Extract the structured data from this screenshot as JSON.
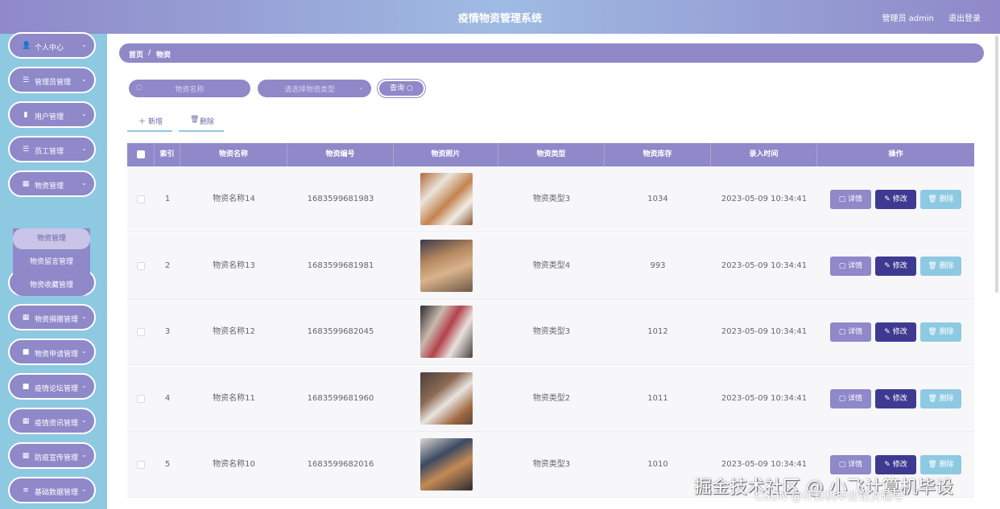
{
  "header": {
    "title": "疫情物资管理系统",
    "user": "管理员 admin",
    "logout": "退出登录"
  },
  "sidebar": {
    "items": [
      {
        "icon": "person-icon",
        "glyph": "👤",
        "label": "个人中心"
      },
      {
        "icon": "list-icon",
        "glyph": "☰",
        "label": "管理员管理"
      },
      {
        "icon": "bar-chart-icon",
        "glyph": "▮",
        "label": "用户管理"
      },
      {
        "icon": "list-icon",
        "glyph": "☰",
        "label": "员工管理"
      },
      {
        "icon": "grid-icon",
        "glyph": "▦",
        "label": "物资管理"
      },
      {
        "icon": "grid-icon",
        "glyph": "▦",
        "label": "出入库管理"
      },
      {
        "icon": "grid-icon",
        "glyph": "▦",
        "label": "物资捐赠管理"
      },
      {
        "icon": "square-icon",
        "glyph": "■",
        "label": "物资申请管理"
      },
      {
        "icon": "square-icon",
        "glyph": "■",
        "label": "疫情论坛管理"
      },
      {
        "icon": "grid-icon",
        "glyph": "▦",
        "label": "疫情资讯管理"
      },
      {
        "icon": "grid-icon",
        "glyph": "▦",
        "label": "防疫宣传管理"
      },
      {
        "icon": "sliders-icon",
        "glyph": "≡",
        "label": "基础数据管理"
      }
    ],
    "submenu": [
      "物资管理",
      "物资留言管理",
      "物资收藏管理"
    ]
  },
  "breadcrumb": {
    "home": "首页",
    "sep": "/",
    "current": "物资"
  },
  "search": {
    "name_placeholder": "物资名称",
    "type_placeholder": "请选择物资类型",
    "query_label": "查询"
  },
  "actions": {
    "add": "新增",
    "delete": "删除"
  },
  "table": {
    "columns": [
      "索引",
      "物资名称",
      "物资编号",
      "物资照片",
      "物资类型",
      "物资库存",
      "录入时间",
      "操作"
    ],
    "rows": [
      {
        "index": "1",
        "name": "物资名称14",
        "code": "1683599681983",
        "type": "物资类型3",
        "stock": "1034",
        "time": "2023-05-09 10:34:41"
      },
      {
        "index": "2",
        "name": "物资名称13",
        "code": "1683599681981",
        "type": "物资类型4",
        "stock": "993",
        "time": "2023-05-09 10:34:41"
      },
      {
        "index": "3",
        "name": "物资名称12",
        "code": "1683599682045",
        "type": "物资类型3",
        "stock": "1012",
        "time": "2023-05-09 10:34:41"
      },
      {
        "index": "4",
        "name": "物资名称11",
        "code": "1683599681960",
        "type": "物资类型2",
        "stock": "1011",
        "time": "2023-05-09 10:34:41"
      },
      {
        "index": "5",
        "name": "物资名称10",
        "code": "1683599682016",
        "type": "物资类型3",
        "stock": "1010",
        "time": "2023-05-09 10:34:41"
      }
    ],
    "row_actions": {
      "detail": "详情",
      "edit": "修改",
      "delete": "删除"
    }
  },
  "watermark": {
    "line1": "掘金技术社区 @ 小飞计算机毕设",
    "line2": "CSDN @计算机毕业论文辅导"
  }
}
